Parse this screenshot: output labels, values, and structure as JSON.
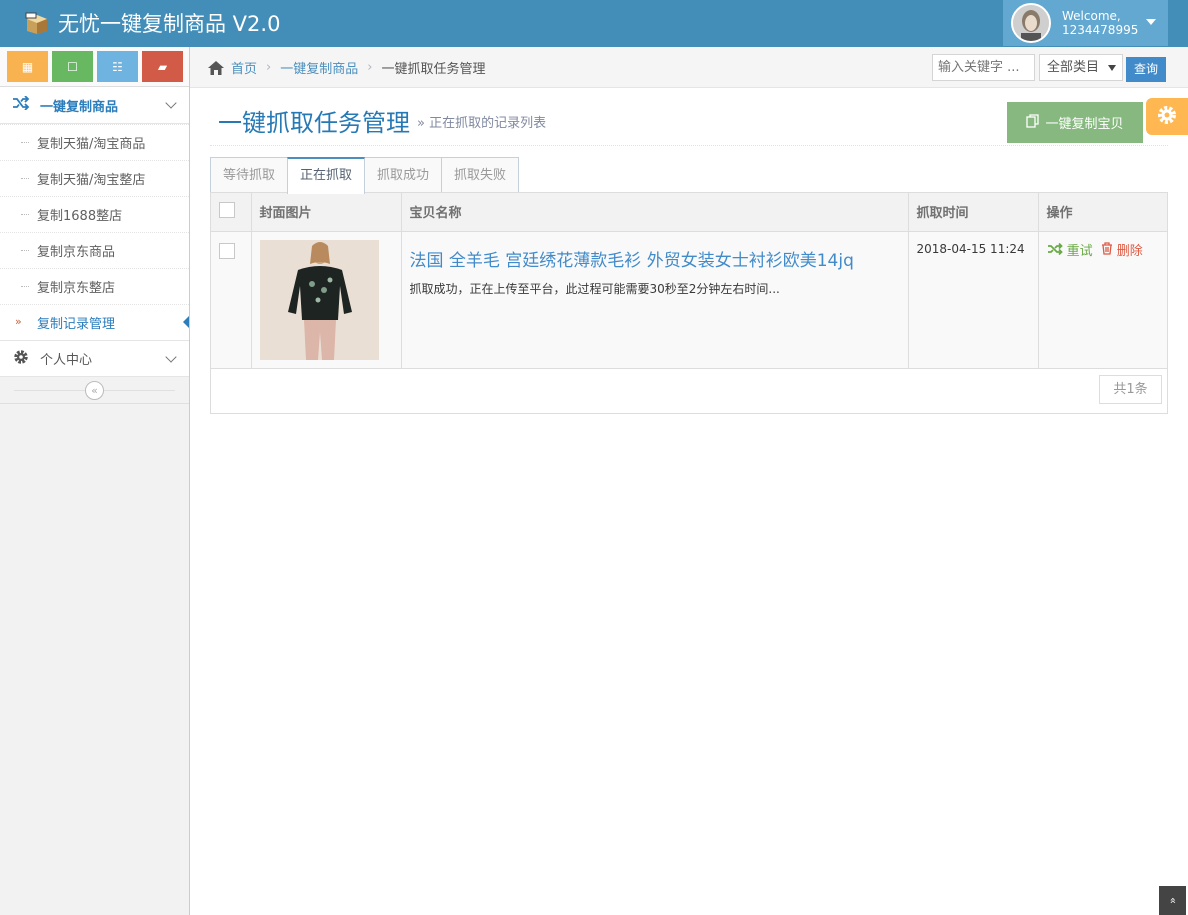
{
  "app": {
    "title": "无忧一键复制商品 V2.0"
  },
  "user": {
    "welcome": "Welcome,",
    "id": "1234478995"
  },
  "colors": {
    "navbar": "#438eb9",
    "primary": "#428bca",
    "success": "#87b87f",
    "warning": "#ffb752",
    "danger": "#d15b47"
  },
  "sidebar": {
    "shortcuts": [
      {
        "icon": "calendar-icon",
        "color": "#f8b350",
        "glyph": "▦"
      },
      {
        "icon": "square-icon",
        "color": "#68b862",
        "glyph": "☐"
      },
      {
        "icon": "list-icon",
        "color": "#6fb3e0",
        "glyph": "☷"
      },
      {
        "icon": "book-icon",
        "color": "#d15b47",
        "glyph": "▰"
      }
    ],
    "group1": {
      "label": "一键复制商品"
    },
    "items": [
      {
        "label": "复制天猫/淘宝商品"
      },
      {
        "label": "复制天猫/淘宝整店"
      },
      {
        "label": "复制1688整店"
      },
      {
        "label": "复制京东商品"
      },
      {
        "label": "复制京东整店"
      },
      {
        "label": "复制记录管理"
      }
    ],
    "group2": {
      "label": "个人中心"
    },
    "collapse_glyph": "«"
  },
  "breadcrumb": {
    "home": "首页",
    "level1": "一键复制商品",
    "current": "一键抓取任务管理",
    "sep": "›"
  },
  "search": {
    "placeholder": "输入关键字 ...",
    "category": "全部类目",
    "button": "查询"
  },
  "page": {
    "title": "一键抓取任务管理",
    "subtitle": "» 正在抓取的记录列表",
    "copy_button": "一键复制宝贝"
  },
  "tabs": [
    "等待抓取",
    "正在抓取",
    "抓取成功",
    "抓取失败"
  ],
  "table": {
    "headers": [
      "封面图片",
      "宝贝名称",
      "抓取时间",
      "操作"
    ],
    "rows": [
      {
        "title": "法国 全羊毛 宫廷绣花薄款毛衫 外贸女装女士衬衫欧美14jq",
        "status": "抓取成功，正在上传至平台，此过程可能需要30秒至2分钟左右时间...",
        "time": "2018-04-15 11:24",
        "retry": "重试",
        "delete": "删除"
      }
    ],
    "total": "共1条"
  },
  "scroll_top_glyph": "»"
}
